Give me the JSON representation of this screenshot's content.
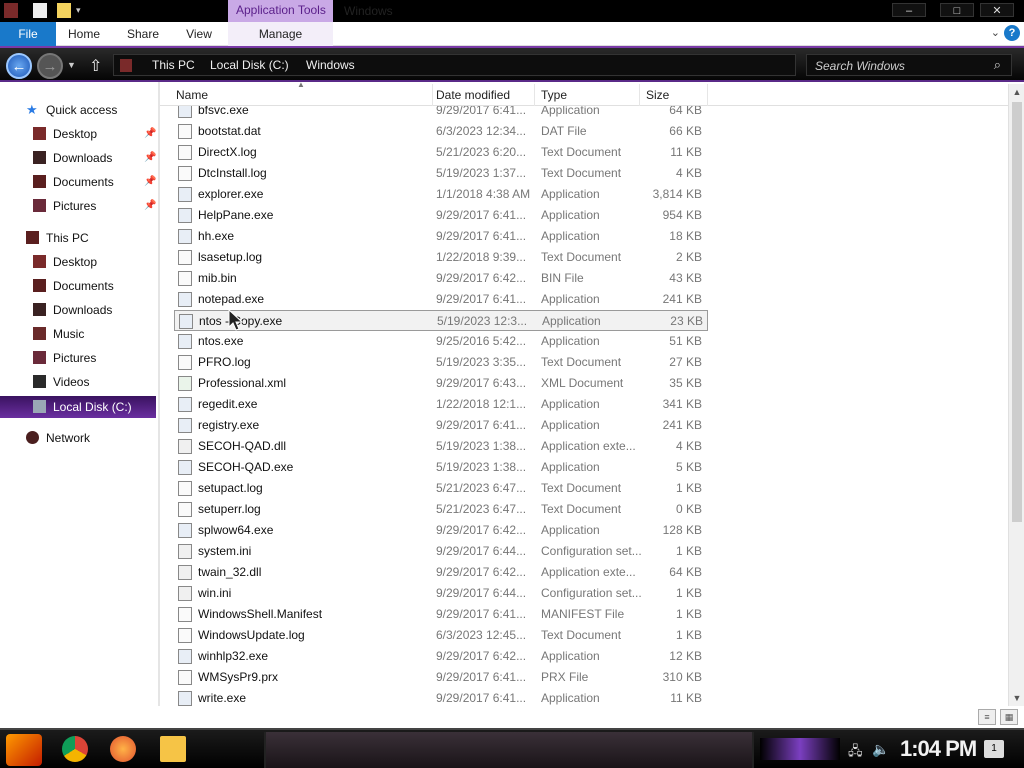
{
  "window": {
    "title": "Windows",
    "context_tab": "Application Tools",
    "buttons": {
      "minimize": "–",
      "maximize": "□",
      "close": "✕"
    }
  },
  "ribbon": {
    "tabs": {
      "file": "File",
      "home": "Home",
      "share": "Share",
      "view": "View",
      "manage": "Manage"
    },
    "help": "?"
  },
  "address_bar": {
    "crumbs": [
      "This PC",
      "Local Disk (C:)",
      "Windows"
    ],
    "search_placeholder": "Search Windows"
  },
  "nav_pane": {
    "quick_access": "Quick access",
    "quick_items": [
      "Desktop",
      "Downloads",
      "Documents",
      "Pictures"
    ],
    "this_pc": "This PC",
    "pc_items": [
      "Desktop",
      "Documents",
      "Downloads",
      "Music",
      "Pictures",
      "Videos",
      "Local Disk (C:)"
    ],
    "network": "Network"
  },
  "columns": {
    "name": "Name",
    "date": "Date modified",
    "type": "Type",
    "size": "Size"
  },
  "files": [
    {
      "name": "bfsvc.exe",
      "date": "9/29/2017 6:41...",
      "type": "Application",
      "size": "64 KB"
    },
    {
      "name": "bootstat.dat",
      "date": "6/3/2023 12:34...",
      "type": "DAT File",
      "size": "66 KB"
    },
    {
      "name": "DirectX.log",
      "date": "5/21/2023 6:20...",
      "type": "Text Document",
      "size": "11 KB"
    },
    {
      "name": "DtcInstall.log",
      "date": "5/19/2023 1:37...",
      "type": "Text Document",
      "size": "4 KB"
    },
    {
      "name": "explorer.exe",
      "date": "1/1/2018 4:38 AM",
      "type": "Application",
      "size": "3,814 KB"
    },
    {
      "name": "HelpPane.exe",
      "date": "9/29/2017 6:41...",
      "type": "Application",
      "size": "954 KB"
    },
    {
      "name": "hh.exe",
      "date": "9/29/2017 6:41...",
      "type": "Application",
      "size": "18 KB"
    },
    {
      "name": "lsasetup.log",
      "date": "1/22/2018 9:39...",
      "type": "Text Document",
      "size": "2 KB"
    },
    {
      "name": "mib.bin",
      "date": "9/29/2017 6:42...",
      "type": "BIN File",
      "size": "43 KB"
    },
    {
      "name": "notepad.exe",
      "date": "9/29/2017 6:41...",
      "type": "Application",
      "size": "241 KB"
    },
    {
      "name": "ntos - Copy.exe",
      "date": "5/19/2023 12:3...",
      "type": "Application",
      "size": "23 KB"
    },
    {
      "name": "ntos.exe",
      "date": "9/25/2016 5:42...",
      "type": "Application",
      "size": "51 KB"
    },
    {
      "name": "PFRO.log",
      "date": "5/19/2023 3:35...",
      "type": "Text Document",
      "size": "27 KB"
    },
    {
      "name": "Professional.xml",
      "date": "9/29/2017 6:43...",
      "type": "XML Document",
      "size": "35 KB"
    },
    {
      "name": "regedit.exe",
      "date": "1/22/2018 12:1...",
      "type": "Application",
      "size": "341 KB"
    },
    {
      "name": "registry.exe",
      "date": "9/29/2017 6:41...",
      "type": "Application",
      "size": "241 KB"
    },
    {
      "name": "SECOH-QAD.dll",
      "date": "5/19/2023 1:38...",
      "type": "Application exte...",
      "size": "4 KB"
    },
    {
      "name": "SECOH-QAD.exe",
      "date": "5/19/2023 1:38...",
      "type": "Application",
      "size": "5 KB"
    },
    {
      "name": "setupact.log",
      "date": "5/21/2023 6:47...",
      "type": "Text Document",
      "size": "1 KB"
    },
    {
      "name": "setuperr.log",
      "date": "5/21/2023 6:47...",
      "type": "Text Document",
      "size": "0 KB"
    },
    {
      "name": "splwow64.exe",
      "date": "9/29/2017 6:42...",
      "type": "Application",
      "size": "128 KB"
    },
    {
      "name": "system.ini",
      "date": "9/29/2017 6:44...",
      "type": "Configuration set...",
      "size": "1 KB"
    },
    {
      "name": "twain_32.dll",
      "date": "9/29/2017 6:42...",
      "type": "Application exte...",
      "size": "64 KB"
    },
    {
      "name": "win.ini",
      "date": "9/29/2017 6:44...",
      "type": "Configuration set...",
      "size": "1 KB"
    },
    {
      "name": "WindowsShell.Manifest",
      "date": "9/29/2017 6:41...",
      "type": "MANIFEST File",
      "size": "1 KB"
    },
    {
      "name": "WindowsUpdate.log",
      "date": "6/3/2023 12:45...",
      "type": "Text Document",
      "size": "1 KB"
    },
    {
      "name": "winhlp32.exe",
      "date": "9/29/2017 6:42...",
      "type": "Application",
      "size": "12 KB"
    },
    {
      "name": "WMSysPr9.prx",
      "date": "9/29/2017 6:41...",
      "type": "PRX File",
      "size": "310 KB"
    },
    {
      "name": "write.exe",
      "date": "9/29/2017 6:41...",
      "type": "Application",
      "size": "11 KB"
    }
  ],
  "hovered_row": 10,
  "taskbar": {
    "clock": "1:04 PM",
    "notifications": "1",
    "icons": [
      "start-icon",
      "chrome-icon",
      "firefox-icon",
      "file-explorer-icon"
    ]
  },
  "colors": {
    "accent": "#1979ca",
    "theme_purple": "#6a2fa0",
    "selection": "#3a1260"
  }
}
